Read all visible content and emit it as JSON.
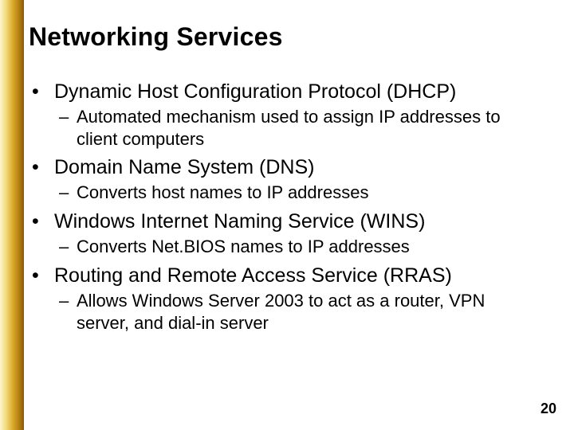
{
  "title": "Networking Services",
  "bullets": [
    {
      "text": "Dynamic Host Configuration Protocol (DHCP)",
      "sub": [
        "Automated mechanism used to assign IP addresses to client computers"
      ]
    },
    {
      "text": "Domain Name System (DNS)",
      "sub": [
        "Converts host names to IP addresses"
      ]
    },
    {
      "text": "Windows Internet Naming Service (WINS)",
      "sub": [
        "Converts Net.BIOS names to IP addresses"
      ]
    },
    {
      "text": "Routing and Remote Access Service (RRAS)",
      "sub": [
        "Allows Windows Server 2003 to act as a router, VPN server, and dial-in server"
      ]
    }
  ],
  "page_number": "20",
  "glyphs": {
    "bullet1": "•",
    "bullet2": "–"
  }
}
